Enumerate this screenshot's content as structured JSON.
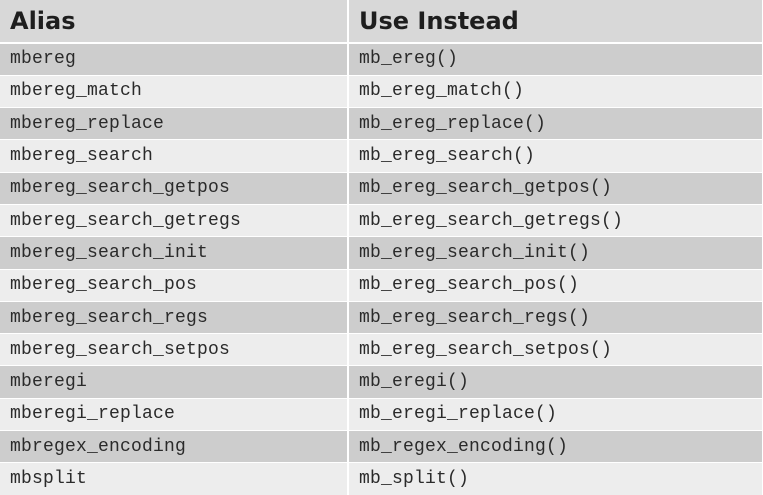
{
  "table": {
    "headers": [
      "Alias",
      "Use Instead"
    ],
    "rows": [
      [
        "mbereg",
        "mb_ereg()"
      ],
      [
        "mbereg_match",
        "mb_ereg_match()"
      ],
      [
        "mbereg_replace",
        "mb_ereg_replace()"
      ],
      [
        "mbereg_search",
        "mb_ereg_search()"
      ],
      [
        "mbereg_search_getpos",
        "mb_ereg_search_getpos()"
      ],
      [
        "mbereg_search_getregs",
        "mb_ereg_search_getregs()"
      ],
      [
        "mbereg_search_init",
        "mb_ereg_search_init()"
      ],
      [
        "mbereg_search_pos",
        "mb_ereg_search_pos()"
      ],
      [
        "mbereg_search_regs",
        "mb_ereg_search_regs()"
      ],
      [
        "mbereg_search_setpos",
        "mb_ereg_search_setpos()"
      ],
      [
        "mberegi",
        "mb_eregi()"
      ],
      [
        "mberegi_replace",
        "mb_eregi_replace()"
      ],
      [
        "mbregex_encoding",
        "mb_regex_encoding()"
      ],
      [
        "mbsplit",
        "mb_split()"
      ]
    ]
  },
  "colors": {
    "header_bg": "#d8d8d8",
    "row_dark": "#cdcdcd",
    "row_light": "#ededed",
    "text": "#2a2a2a"
  }
}
